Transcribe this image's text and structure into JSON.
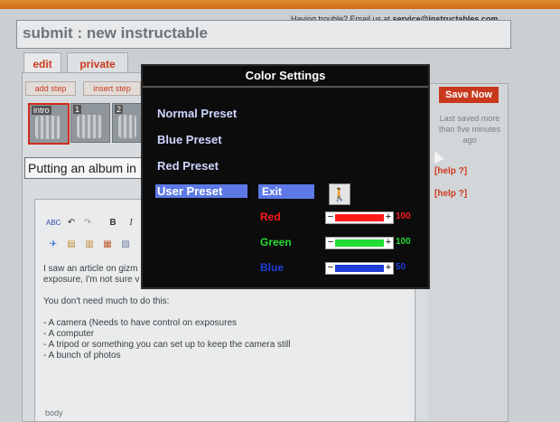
{
  "header": {
    "trouble_prefix": "Having trouble? Email us at",
    "email": "service@instructables.com"
  },
  "page": {
    "title": "submit : new instructable"
  },
  "tabs": [
    {
      "label": "edit",
      "active": true
    },
    {
      "label": "private",
      "active": false
    }
  ],
  "toolbar": {
    "add_step": "add step",
    "insert_step": "insert step"
  },
  "steps": [
    {
      "label": "intro",
      "selected": true
    },
    {
      "label": "1",
      "selected": false
    },
    {
      "label": "2",
      "selected": false
    }
  ],
  "step_title_value": "Putting an album in",
  "editor": {
    "lines": [
      "I saw an article on gizm",
      "exposure, I'm not sure v",
      "",
      "You don't need much to do this:",
      "",
      "- A camera (Needs to have control on exposures",
      "- A computer",
      "- A tripod or something you can set up to keep the camera still",
      "- A bunch of photos"
    ],
    "body_label": "body",
    "toolbar_icons": [
      "spellcheck-icon",
      "undo-icon",
      "redo-icon",
      "bold-icon",
      "italic-icon",
      "image-icon",
      "paste-icon",
      "paste-word-icon",
      "paste-text-icon",
      "table-icon"
    ]
  },
  "sidebar": {
    "save_label": "Save Now",
    "last_saved": "Last saved more than five minutes ago",
    "help_1": "[help ?]",
    "help_2": "[help ?]"
  },
  "osd": {
    "title": "Color Settings",
    "presets": [
      {
        "label": "Normal Preset",
        "selected": false
      },
      {
        "label": "Blue Preset",
        "selected": false
      },
      {
        "label": "Red Preset",
        "selected": false
      },
      {
        "label": "User Preset",
        "selected": true
      }
    ],
    "exit_label": "Exit",
    "channels": [
      {
        "name": "Red",
        "value": "100",
        "level": 1.0,
        "color": "#ff1a1a"
      },
      {
        "name": "Green",
        "value": "100",
        "level": 1.0,
        "color": "#22dd33"
      },
      {
        "name": "Blue",
        "value": "50",
        "level": 1.0,
        "color": "#1f3fd8"
      }
    ]
  },
  "colors": {
    "accent": "#cc3a1c",
    "osd_highlight": "#5c79e6"
  }
}
